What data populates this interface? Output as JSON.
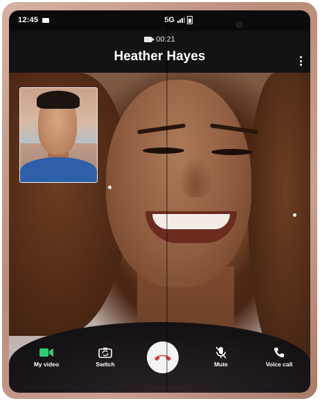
{
  "status_bar": {
    "time": "12:45",
    "network": "5G"
  },
  "call": {
    "duration": "00:21",
    "caller_name": "Heather Hayes"
  },
  "controls": {
    "my_video": "My video",
    "switch": "Switch",
    "mute": "Mute",
    "voice_call": "Voice call"
  },
  "colors": {
    "my_video_accent": "#2ecc71",
    "end_call_red": "#e2322e"
  },
  "icons": [
    "video-icon",
    "camera-switch-icon",
    "end-call-icon",
    "mic-off-icon",
    "phone-icon",
    "more-options-icon"
  ]
}
